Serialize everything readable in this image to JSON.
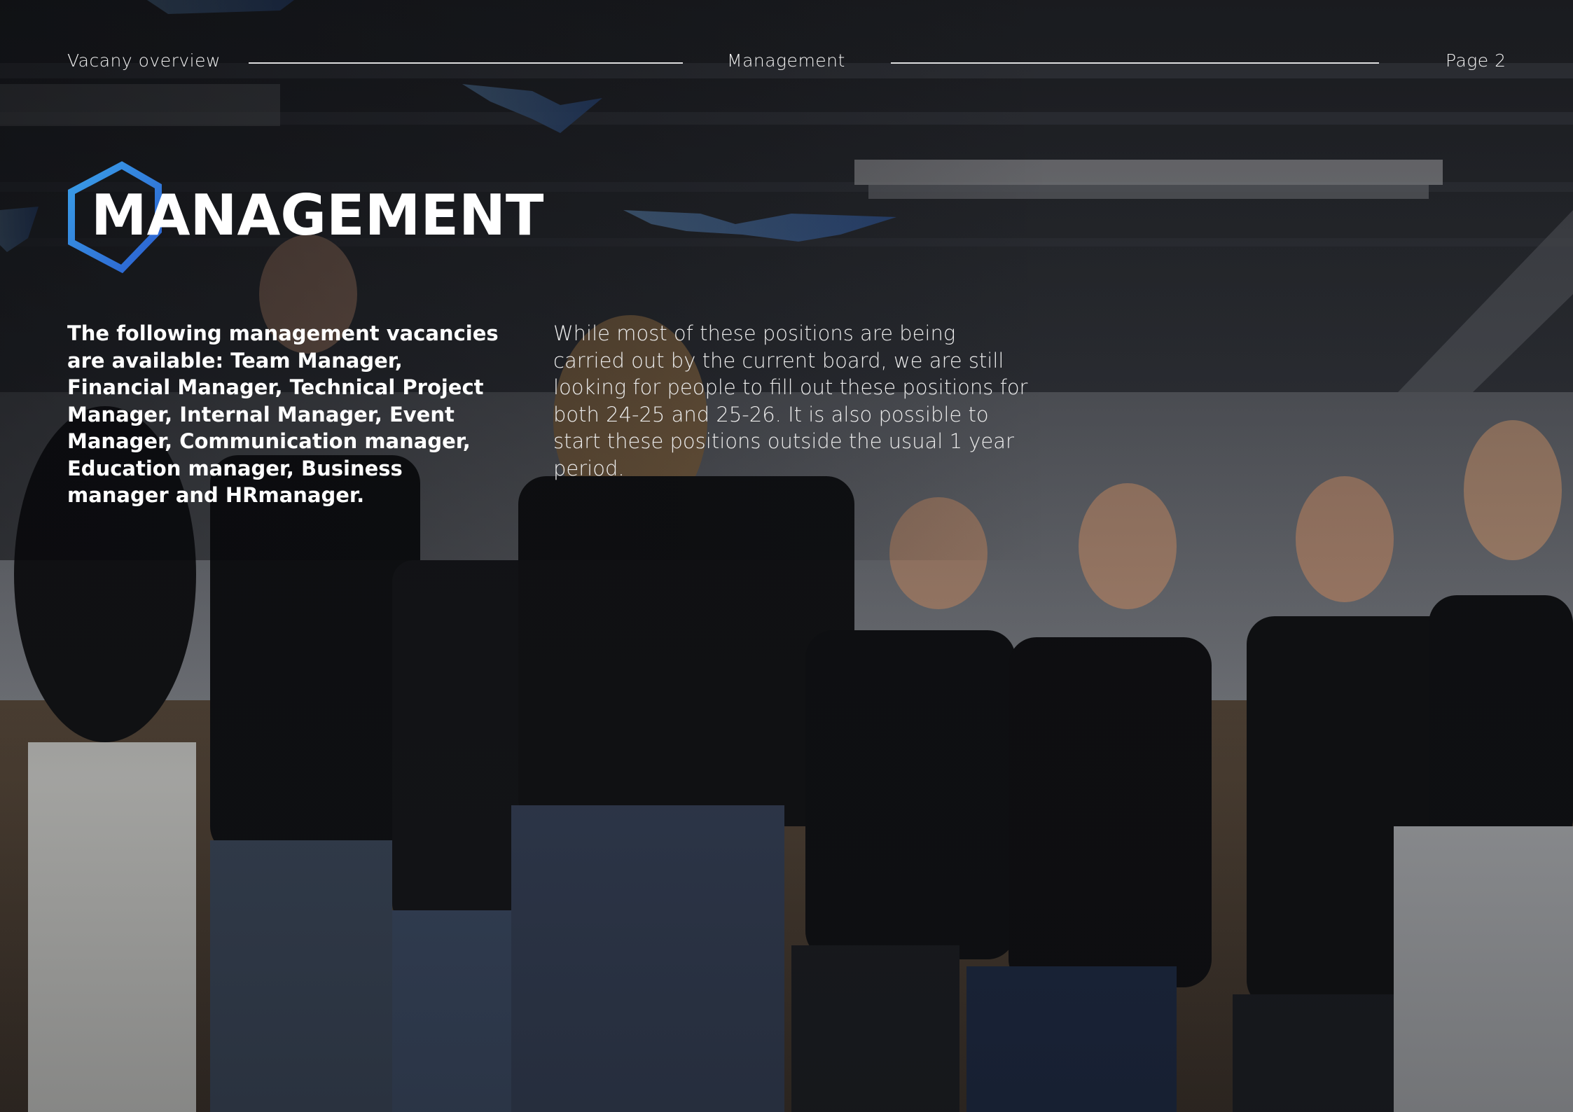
{
  "header": {
    "left_label": "Vacany overview",
    "center_label": "Management",
    "right_label": "Page 2"
  },
  "title": {
    "text": "MANAGEMENT",
    "logo_icon": "hexagon-outline-icon",
    "logo_colors": [
      "#3aa0e8",
      "#2b5fd0"
    ]
  },
  "content": {
    "lead": "The following management vacancies are available: Team Manager, Financial Manager, Technical Project Manager, Internal Manager, Event Manager, Communication manager, Education manager, Business manager and HRmanager.",
    "body": "While most of these positions are being carried out by the current board, we are still looking for people to fill out these positions for both 24-25 and 25-26. It is also possible to start these positions outside the usual 1 year period."
  },
  "background": {
    "description_icon": "team-photo-background",
    "overlay_color": "#0c0d10"
  }
}
